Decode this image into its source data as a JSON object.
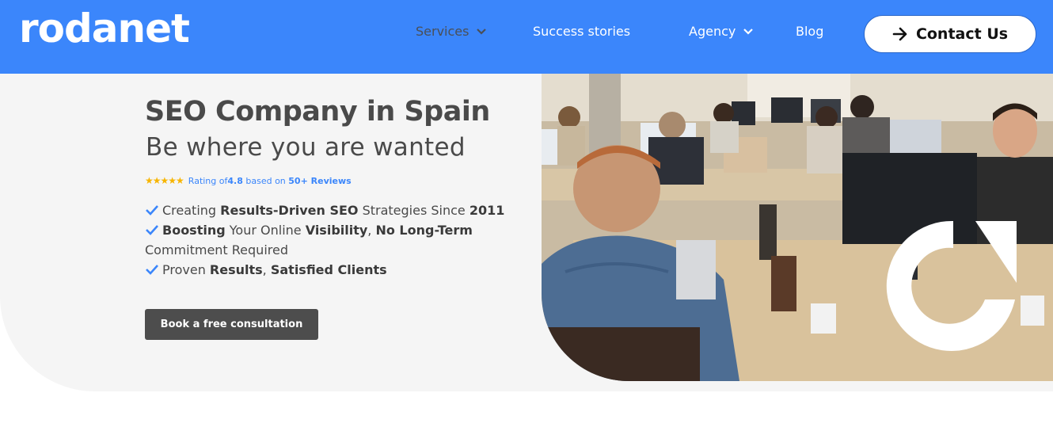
{
  "header": {
    "logo_text": "rodanet",
    "nav": [
      {
        "label": "Services",
        "has_dropdown": true,
        "active": true
      },
      {
        "label": "Success stories",
        "has_dropdown": false
      },
      {
        "label": "Agency",
        "has_dropdown": true
      },
      {
        "label": "Blog",
        "has_dropdown": false
      }
    ],
    "contact_label": "Contact Us"
  },
  "hero": {
    "title": "SEO Company in Spain",
    "subtitle": "Be where you are wanted",
    "rating": {
      "stars": 5,
      "prefix": "Rating of ",
      "value": "4.8",
      "middle": " based on ",
      "reviews": "50+ Reviews"
    },
    "features": [
      {
        "parts": [
          "Creating ",
          "Results-Driven SEO",
          " Strategies Since ",
          "2011"
        ]
      },
      {
        "parts": [
          "Boosting",
          " Your Online ",
          "Visibility",
          ", ",
          "No Long-Term",
          " Commitment Required"
        ]
      },
      {
        "parts": [
          "Proven ",
          "Results",
          ", ",
          "Satisfied Clients"
        ]
      }
    ],
    "cta_label": "Book a free consultation"
  },
  "colors": {
    "brand_blue": "#3b86fb",
    "star": "#f7b500",
    "text": "#4a4a4a",
    "cta_bg": "#4d4d4d"
  }
}
